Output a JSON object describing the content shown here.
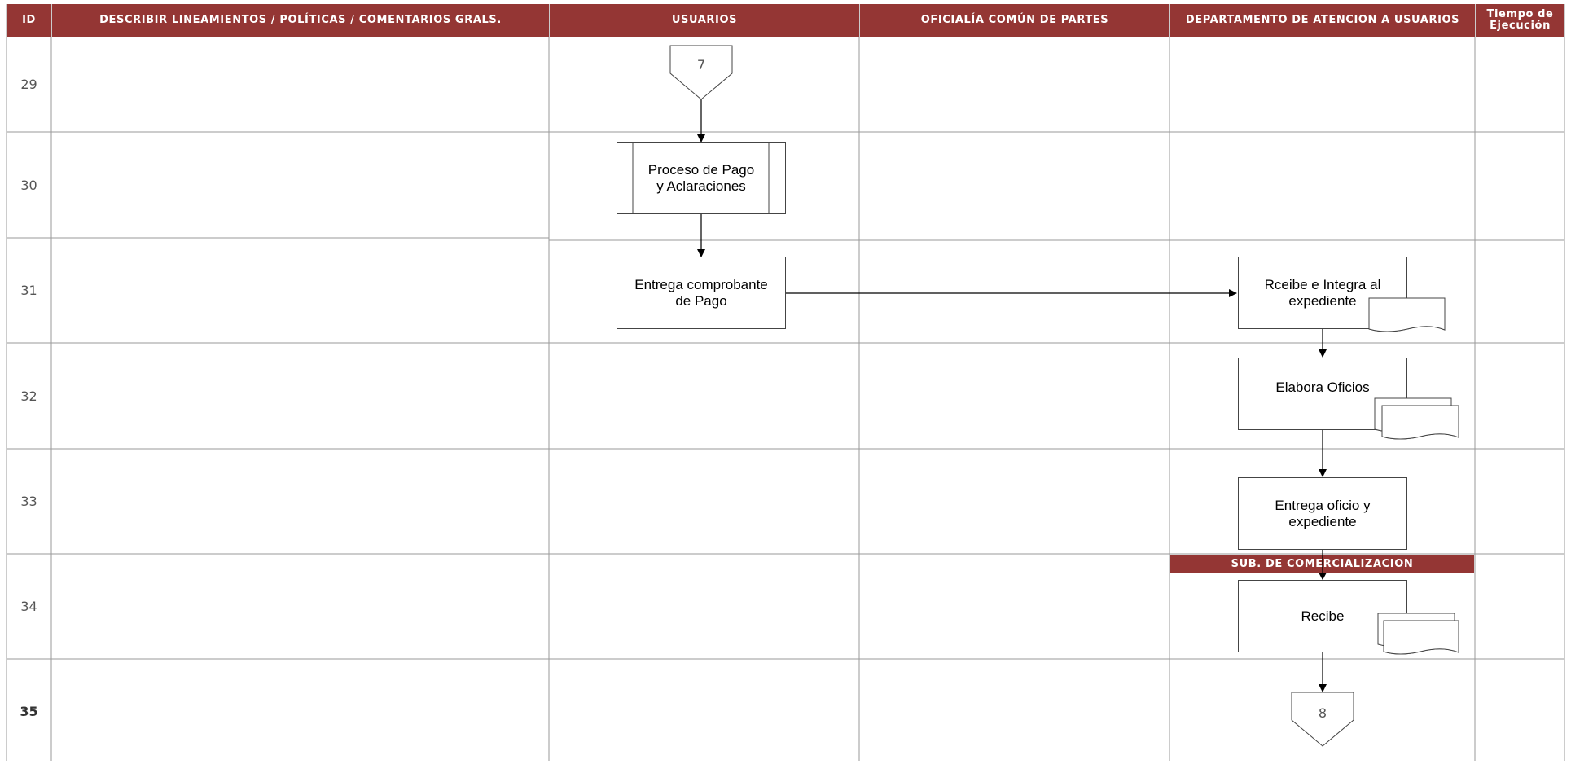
{
  "headers": {
    "id": "ID",
    "description": "DESCRIBIR LINEAMIENTOS / POLÍTICAS / COMENTARIOS GRALS.",
    "usuarios": "USUARIOS",
    "oficialia": "OFICIALÍA COMÚN DE PARTES",
    "departamento": "DEPARTAMENTO DE ATENCION A USUARIOS",
    "tiempo_line1": "Tiempo de",
    "tiempo_line2": "Ejecución"
  },
  "rows": [
    "29",
    "30",
    "31",
    "32",
    "33",
    "34",
    "35"
  ],
  "connectors": {
    "top": "7",
    "bottom": "8"
  },
  "steps": {
    "proceso_line1": "Proceso de Pago",
    "proceso_line2": "y Aclaraciones",
    "entrega_comprobante_line1": "Entrega comprobante",
    "entrega_comprobante_line2": "de Pago",
    "recibe_integra_line1": "Rceibe e Integra al",
    "recibe_integra_line2": "expediente",
    "elabora_oficios": "Elabora Oficios",
    "entrega_oficio_line1": "Entrega oficio y",
    "entrega_oficio_line2": "expediente",
    "recibe": "Recibe"
  },
  "sub_label": "SUB. DE COMERCIALIZACION",
  "colors": {
    "header_bg": "#943634",
    "header_text": "#ffffff",
    "grid": "#9a9a9a"
  }
}
